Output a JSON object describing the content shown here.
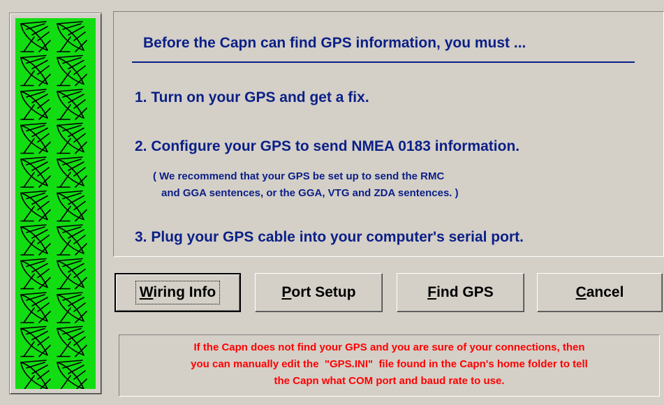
{
  "sidebar": {
    "icon": "satellite-dish-icon",
    "background_color": "#12dc12",
    "tile_rows": 11,
    "tile_cols": 2
  },
  "panel": {
    "title": "Before the Capn can find GPS information, you must ...",
    "step1": "1.  Turn on your GPS and get a fix.",
    "step2": "2.  Configure your GPS to send NMEA 0183 information.",
    "note_line1": "( We recommend that your GPS be set up to send the RMC",
    "note_line2": "and GGA sentences, or the GGA, VTG and ZDA sentences. )",
    "step3": "3.  Plug your GPS cable into your computer's serial port.",
    "text_color": "#0b1f86"
  },
  "buttons": [
    {
      "mnemonic": "W",
      "rest": "iring Info"
    },
    {
      "mnemonic": "P",
      "rest": "ort Setup"
    },
    {
      "mnemonic": "F",
      "rest": "ind GPS"
    },
    {
      "mnemonic": "C",
      "rest": "ancel"
    }
  ],
  "hint": {
    "line1": "If the Capn does not find your GPS and you are sure of your connections, then",
    "line2": "you can manually edit the  \"GPS.INI\"  file found in the Capn's home folder to tell",
    "line3": "the Capn what COM port and baud rate to use.",
    "text_color": "#ff0000"
  }
}
